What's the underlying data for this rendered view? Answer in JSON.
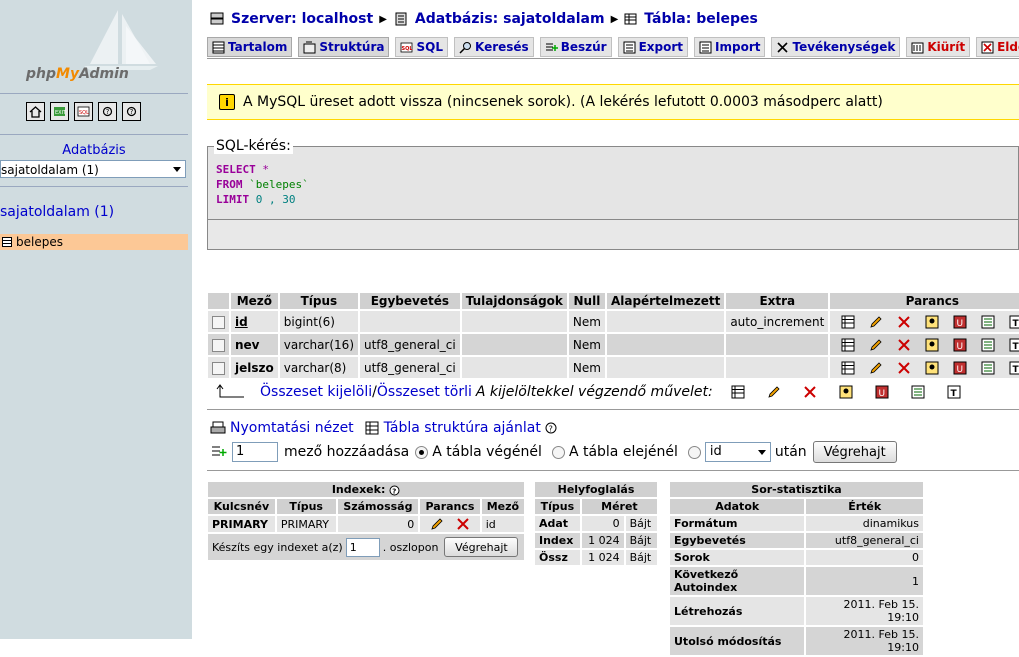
{
  "left": {
    "logo_text_php": "php",
    "logo_text_my": "My",
    "logo_text_admin": "Admin",
    "db_label": "Adatbázis",
    "db_select_value": "sajatoldalam (1)",
    "db_link": "sajatoldalam (1)",
    "table_item": "belepes"
  },
  "breadcrumb": {
    "server": "Szerver: localhost",
    "database": "Adatbázis: sajatoldalam",
    "table": "Tábla: belepes"
  },
  "tabs": [
    {
      "label": "Tartalom"
    },
    {
      "label": "Struktúra"
    },
    {
      "label": "SQL"
    },
    {
      "label": "Keresés"
    },
    {
      "label": "Beszúr"
    },
    {
      "label": "Export"
    },
    {
      "label": "Import"
    },
    {
      "label": "Tevékenységek"
    },
    {
      "label": "Kiürít"
    },
    {
      "label": "Eldob"
    }
  ],
  "notice": "A MySQL üreset adott vissza (nincsenek sorok). (A lekérés lefutott 0.0003 másodperc alatt)",
  "sql": {
    "legend": "SQL-kérés:",
    "select": "SELECT",
    "star": " *",
    "from": "FROM",
    "table": " `belepes`",
    "limit": "LIMIT",
    "limit_vals": " 0 , 30"
  },
  "structure": {
    "headers": [
      "Mező",
      "Típus",
      "Egybevetés",
      "Tulajdonságok",
      "Null",
      "Alapértelmezett",
      "Extra",
      "Parancs"
    ],
    "rows": [
      {
        "field": "id",
        "type": "bigint(6)",
        "collation": "",
        "attrs": "",
        "null": "Nem",
        "default": "",
        "extra": "auto_increment"
      },
      {
        "field": "nev",
        "type": "varchar(16)",
        "collation": "utf8_general_ci",
        "attrs": "",
        "null": "Nem",
        "default": "",
        "extra": ""
      },
      {
        "field": "jelszo",
        "type": "varchar(8)",
        "collation": "utf8_general_ci",
        "attrs": "",
        "null": "Nem",
        "default": "",
        "extra": ""
      }
    ],
    "select_all": "Összeset kijelöli",
    "sep": " / ",
    "deselect_all": "Összeset törli",
    "with_selected": "A kijelöltekkel végzendő művelet:"
  },
  "actions": {
    "print_view": "Nyomtatási nézet",
    "propose": "Tábla struktúra ajánlat",
    "add_count": "1",
    "add_fields": "mező hozzáadása",
    "at_end": "A tábla végénél",
    "at_begin": "A tábla elejénél",
    "after_select": "id",
    "after": "után",
    "go": "Végrehajt"
  },
  "indexes": {
    "title": "Indexek:",
    "headers": [
      "Kulcsnév",
      "Típus",
      "Számosság",
      "Parancs",
      "Mező"
    ],
    "row": {
      "name": "PRIMARY",
      "type": "PRIMARY",
      "card": "0",
      "field": "id"
    },
    "create_prefix": "Készíts egy indexet a(z)",
    "create_count": "1",
    "create_suffix": ". oszlopon",
    "go": "Végrehajt"
  },
  "space": {
    "title": "Helyfoglalás",
    "headers": [
      "Típus",
      "Méret"
    ],
    "rows": [
      {
        "type": "Adat",
        "size": "0",
        "unit": "Bájt"
      },
      {
        "type": "Index",
        "size": "1 024",
        "unit": "Bájt"
      },
      {
        "type": "Össz",
        "size": "1 024",
        "unit": "Bájt"
      }
    ]
  },
  "stats": {
    "title": "Sor-statisztika",
    "headers": [
      "Adatok",
      "Érték"
    ],
    "rows": [
      {
        "k": "Formátum",
        "v": "dinamikus"
      },
      {
        "k": "Egybevetés",
        "v": "utf8_general_ci"
      },
      {
        "k": "Sorok",
        "v": "0"
      },
      {
        "k": "Következő Autoindex",
        "v": "1"
      },
      {
        "k": "Létrehozás",
        "v": "2011. Feb 15. 19:10"
      },
      {
        "k": "Utolsó módosítás",
        "v": "2011. Feb 15. 19:10"
      }
    ]
  }
}
